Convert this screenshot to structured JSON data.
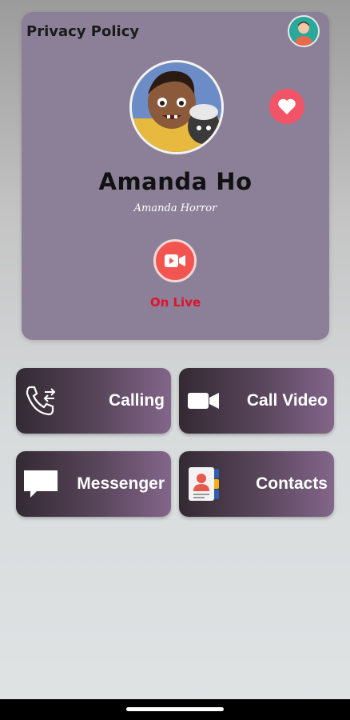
{
  "header": {
    "privacy_label": "Privacy Policy"
  },
  "profile": {
    "name": "Amanda Ho",
    "subtitle": "Amanda Horror",
    "live_label": "On Live"
  },
  "actions": [
    {
      "label": "Calling",
      "icon": "phone-transfer-icon"
    },
    {
      "label": "Call Video",
      "icon": "video-camera-icon"
    },
    {
      "label": "Messenger",
      "icon": "chat-bubble-icon"
    },
    {
      "label": "Contacts",
      "icon": "contacts-book-icon"
    }
  ],
  "colors": {
    "card": "#8c8099",
    "heart": "#f05466",
    "live": "#f25550",
    "live_text": "#e0112b"
  }
}
